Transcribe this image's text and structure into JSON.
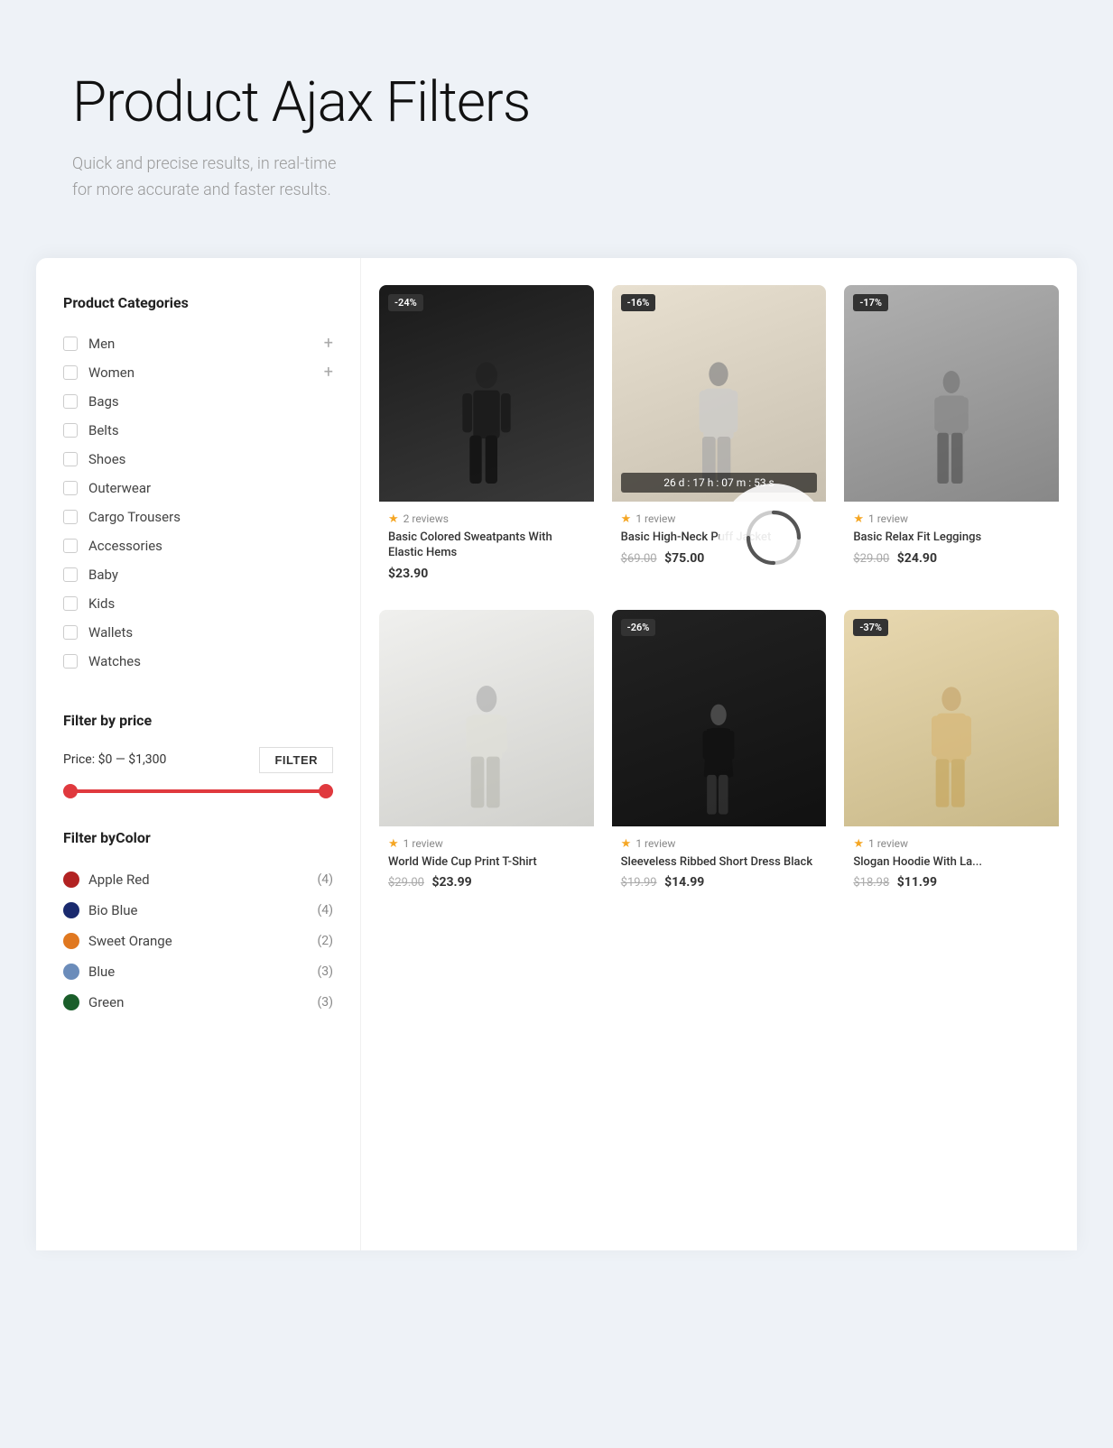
{
  "hero": {
    "title": "Product Ajax Filters",
    "subtitle_line1": "Quick and precise results, in real-time",
    "subtitle_line2": "for more accurate and faster results."
  },
  "sidebar": {
    "categories_title": "Product Categories",
    "categories": [
      {
        "id": "men",
        "label": "Men",
        "has_expand": true
      },
      {
        "id": "women",
        "label": "Women",
        "has_expand": true
      },
      {
        "id": "bags",
        "label": "Bags",
        "has_expand": false
      },
      {
        "id": "belts",
        "label": "Belts",
        "has_expand": false
      },
      {
        "id": "shoes",
        "label": "Shoes",
        "has_expand": false
      },
      {
        "id": "outerwear",
        "label": "Outerwear",
        "has_expand": false
      },
      {
        "id": "cargo-trousers",
        "label": "Cargo Trousers",
        "has_expand": false
      },
      {
        "id": "accessories",
        "label": "Accessories",
        "has_expand": false
      },
      {
        "id": "baby",
        "label": "Baby",
        "has_expand": false
      },
      {
        "id": "kids",
        "label": "Kids",
        "has_expand": false
      },
      {
        "id": "wallets",
        "label": "Wallets",
        "has_expand": false
      },
      {
        "id": "watches",
        "label": "Watches",
        "has_expand": false
      }
    ],
    "price_filter": {
      "title": "Filter by price",
      "price_label": "Price:",
      "price_min": "$0",
      "price_separator": "—",
      "price_max": "$1,300",
      "filter_button": "FILTER",
      "slider_min": 0,
      "slider_max": 1300
    },
    "color_filter": {
      "title": "Filter byColor",
      "colors": [
        {
          "id": "apple-red",
          "name": "Apple Red",
          "hex": "#b22222",
          "count": 4
        },
        {
          "id": "bio-blue",
          "name": "Bio Blue",
          "hex": "#1a2a6e",
          "count": 4
        },
        {
          "id": "sweet-orange",
          "name": "Sweet Orange",
          "hex": "#e07820",
          "count": 2
        },
        {
          "id": "blue",
          "name": "Blue",
          "hex": "#6b8cba",
          "count": 3
        },
        {
          "id": "green",
          "name": "Green",
          "hex": "#1a5e2a",
          "count": 3
        }
      ]
    }
  },
  "products": [
    {
      "id": "p1",
      "badge": "-24%",
      "rating_stars": 1,
      "reviews": "2 reviews",
      "name": "Basic Colored Sweatpants With Elastic Hems",
      "old_price": null,
      "price": "$23.90",
      "bg_class": "img-sweatpants",
      "has_countdown": false
    },
    {
      "id": "p2",
      "badge": "-16%",
      "rating_stars": 1,
      "reviews": "1 review",
      "name": "Basic High-Neck Puff Jacket",
      "old_price": "$69.00",
      "price": "$75.00",
      "bg_class": "img-jacket",
      "has_countdown": true,
      "countdown": "26 d : 17 h : 07 m : 53 s"
    },
    {
      "id": "p3",
      "badge": "-17%",
      "rating_stars": 1,
      "reviews": "1 review",
      "name": "Basic Relax Fit Leggings",
      "old_price": "$29.00",
      "price": "$24.90",
      "bg_class": "img-legging",
      "has_countdown": false
    },
    {
      "id": "p4",
      "badge": null,
      "rating_stars": 1,
      "reviews": "1 review",
      "name": "World Wide Cup Print T-Shirt",
      "old_price": "$29.00",
      "price": "$23.99",
      "bg_class": "img-tshirt",
      "has_countdown": false
    },
    {
      "id": "p5",
      "badge": "-26%",
      "rating_stars": 1,
      "reviews": "1 review",
      "name": "Sleeveless Ribbed Short Dress Black",
      "old_price": "$19.99",
      "price": "$14.99",
      "bg_class": "img-dress",
      "has_countdown": false
    },
    {
      "id": "p6",
      "badge": "-37%",
      "rating_stars": 1,
      "reviews": "1 review",
      "name": "Slogan Hoodie With La...",
      "old_price": "$18.98",
      "price": "$11.99",
      "bg_class": "img-hoodie",
      "has_countdown": false
    }
  ]
}
